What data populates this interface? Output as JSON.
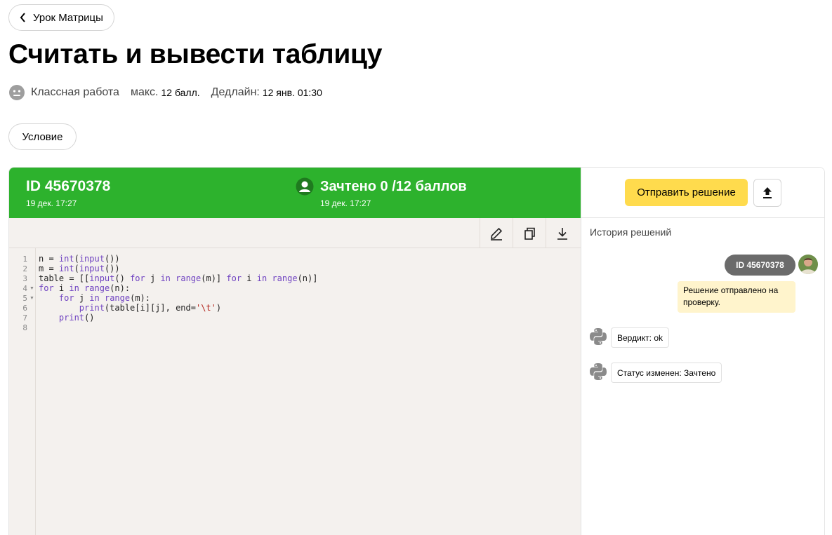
{
  "header": {
    "back_label": "Урок Матрицы",
    "title": "Считать и вывести таблицу"
  },
  "meta": {
    "type_label": "Классная работа",
    "max_label": "макс.",
    "max_value": "12 балл.",
    "deadline_label": "Дедлайн:",
    "deadline_value": "12 янв. 01:30"
  },
  "tabs": {
    "condition_label": "Условие"
  },
  "solution": {
    "id_label": "ID 45670378",
    "date": "19 дек. 17:27",
    "verdict": "Зачтено 0 /12 баллов",
    "verdict_date": "19 дек. 17:27",
    "colors": {
      "status_bg": "#2db22d",
      "submit_bg": "#ffdb4d",
      "editor_bg": "#f4f1ee"
    }
  },
  "editor": {
    "toolbar_icons": [
      "pencil-icon",
      "copy-icon",
      "download-icon"
    ],
    "line_numbers": [
      "1",
      "2",
      "3",
      "4",
      "5",
      "6",
      "7",
      "8"
    ],
    "code_lines": [
      "n = int(input())",
      "m = int(input())",
      "table = [[input() for j in range(m)] for i in range(n)]",
      "for i in range(n):",
      "    for j in range(m):",
      "        print(table[i][j], end='\\t')",
      "    print()",
      ""
    ]
  },
  "sidebar": {
    "submit_label": "Отправить решение",
    "upload_icon": "upload-icon",
    "history_title": "История решений",
    "messages": {
      "id_pill": "ID 45670378",
      "sent_text": "Решение отправлено на проверку.",
      "verdict_msg": "Вердикт: ok",
      "status_msg": "Статус изменен: Зачтено"
    }
  }
}
